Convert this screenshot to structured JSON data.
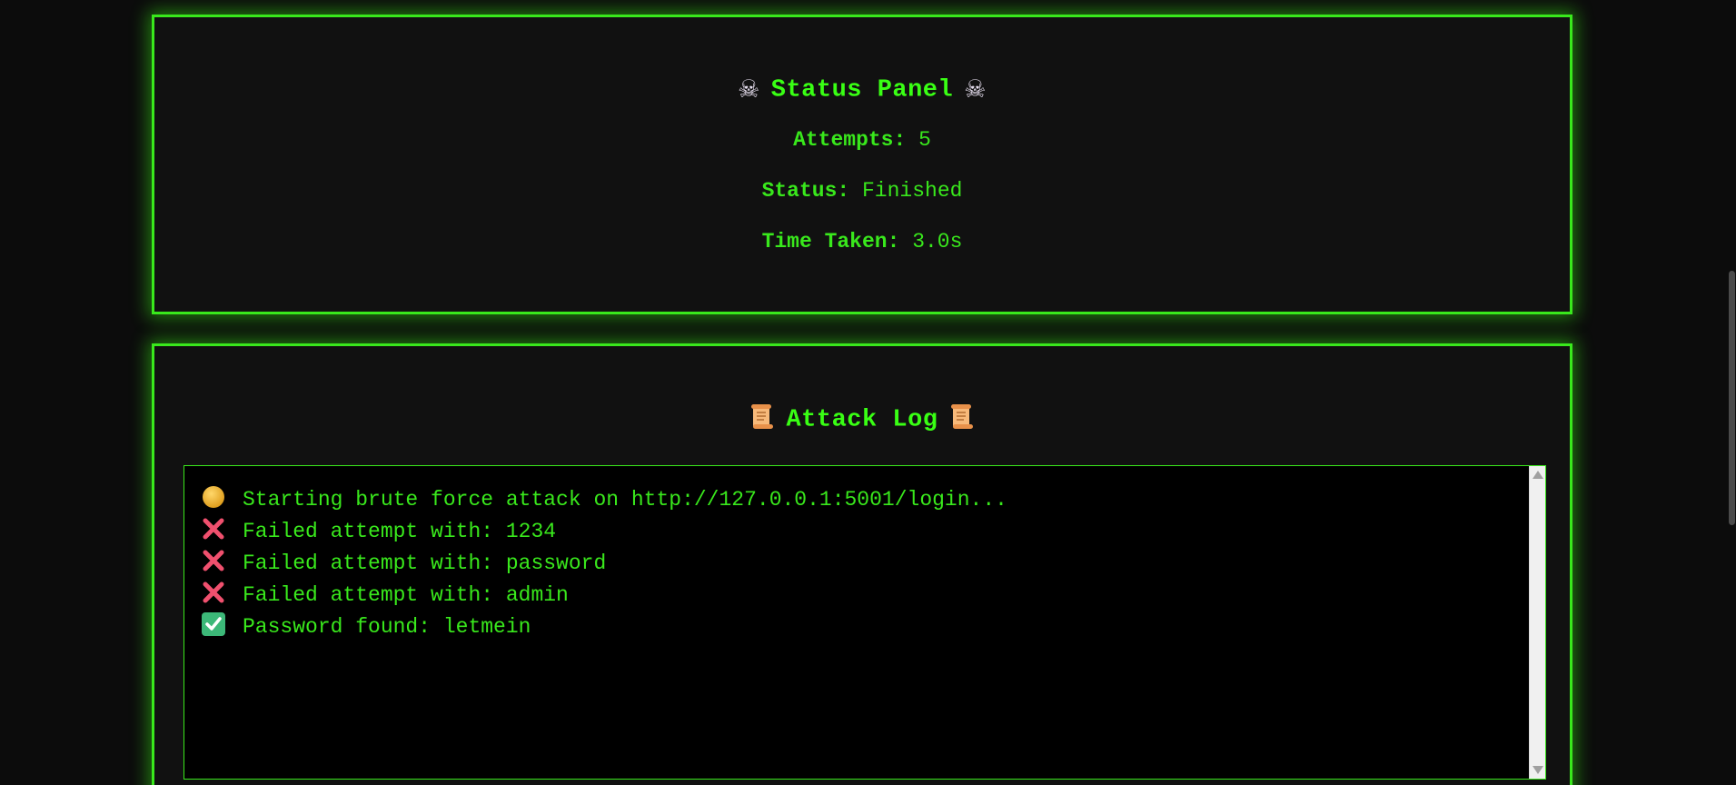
{
  "status_panel": {
    "title": "Status Panel",
    "title_icon": "skull-crossbones-icon",
    "attempts_label": "Attempts:",
    "attempts_value": "5",
    "status_label": "Status:",
    "status_value": "Finished",
    "time_label": "Time Taken:",
    "time_value": "3.0s"
  },
  "log_panel": {
    "title": "Attack Log",
    "title_icon": "scroll-icon",
    "lines": [
      {
        "icon": "yellow-circle-icon",
        "text": "Starting brute force attack on http://127.0.0.1:5001/login..."
      },
      {
        "icon": "cross-mark-icon",
        "text": "Failed attempt with: 1234"
      },
      {
        "icon": "cross-mark-icon",
        "text": "Failed attempt with: password"
      },
      {
        "icon": "cross-mark-icon",
        "text": "Failed attempt with: admin"
      },
      {
        "icon": "check-mark-icon",
        "text": "Password found: letmein"
      }
    ]
  },
  "colors": {
    "accent": "#39ff14",
    "background": "#0c0c0c",
    "panel": "#111111",
    "log_background": "#000000",
    "cross": "#f0506e",
    "check": "#3cb878"
  }
}
